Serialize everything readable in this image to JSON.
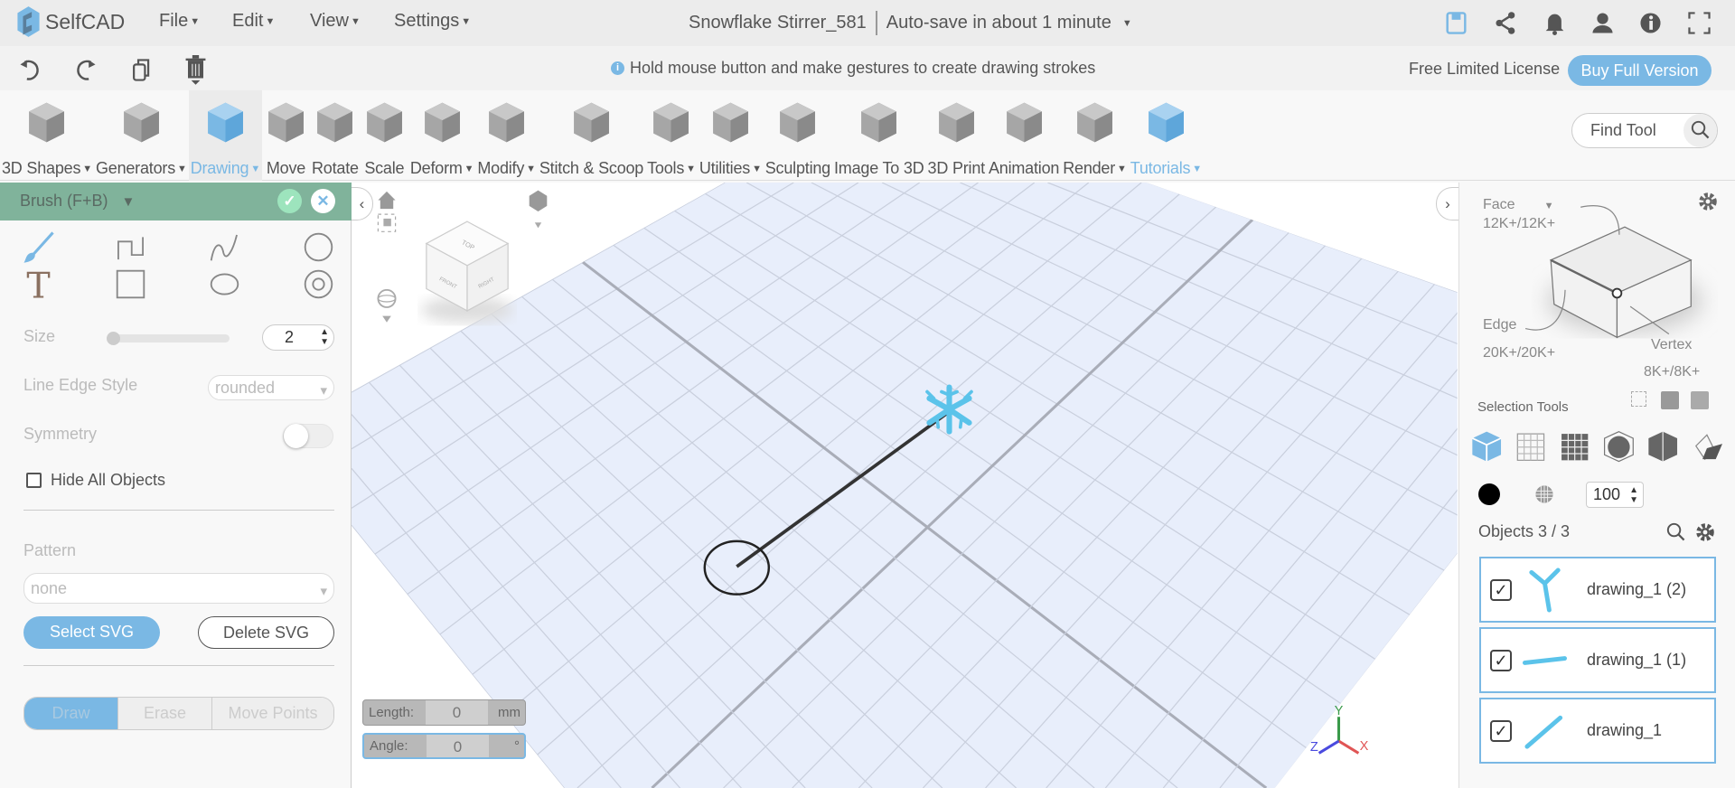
{
  "app": {
    "name": "SelfCAD"
  },
  "menu": [
    "File",
    "Edit",
    "View",
    "Settings"
  ],
  "document": {
    "title": "Snowflake Stirrer_581",
    "autosave": "Auto-save in about 1 minute"
  },
  "top_icons": [
    "save-icon",
    "share-icon",
    "bell-icon",
    "user-icon",
    "info-icon",
    "fullscreen-icon"
  ],
  "actions": [
    "undo-icon",
    "redo-icon",
    "copy-icon",
    "delete-icon"
  ],
  "hint": "Hold mouse button and make gestures to create drawing strokes",
  "license": "Free Limited License",
  "buy_label": "Buy Full Version",
  "toolbar": [
    {
      "label": "3D Shapes",
      "dropdown": true,
      "icon": "cube-icon"
    },
    {
      "label": "Generators",
      "dropdown": true,
      "icon": "generators-icon"
    },
    {
      "label": "Drawing",
      "dropdown": true,
      "icon": "drawing-icon",
      "active": true
    },
    {
      "label": "Move",
      "icon": "move-icon"
    },
    {
      "label": "Rotate",
      "icon": "rotate-icon"
    },
    {
      "label": "Scale",
      "icon": "scale-icon"
    },
    {
      "label": "Deform",
      "dropdown": true,
      "icon": "deform-icon"
    },
    {
      "label": "Modify",
      "dropdown": true,
      "icon": "modify-icon"
    },
    {
      "label": "Stitch & Scoop",
      "icon": "stitch-scoop-icon"
    },
    {
      "label": "Tools",
      "dropdown": true,
      "icon": "tools-icon"
    },
    {
      "label": "Utilities",
      "dropdown": true,
      "icon": "utilities-icon"
    },
    {
      "label": "Sculpting",
      "icon": "sculpting-icon"
    },
    {
      "label": "Image To 3D",
      "icon": "image-to-3d-icon"
    },
    {
      "label": "3D Print",
      "icon": "3d-print-icon"
    },
    {
      "label": "Animation",
      "icon": "animation-icon"
    },
    {
      "label": "Render",
      "dropdown": true,
      "icon": "render-icon"
    },
    {
      "label": "Tutorials",
      "dropdown": true,
      "icon": "tutorials-icon",
      "blue": true
    }
  ],
  "find_tool": "Find Tool",
  "brush": {
    "title": "Brush (F+B)",
    "size_label": "Size",
    "size_value": "2",
    "size_fraction": 0.0,
    "edge_label": "Line Edge Style",
    "edge_value": "rounded",
    "symmetry_label": "Symmetry",
    "symmetry_on": false,
    "hide_label": "Hide All Objects",
    "pattern_label": "Pattern",
    "pattern_value": "none",
    "select_svg": "Select SVG",
    "delete_svg": "Delete SVG",
    "modes": [
      "Draw",
      "Erase",
      "Move Points"
    ]
  },
  "measure": {
    "length_label": "Length:",
    "length_value": "0",
    "length_unit": "mm",
    "angle_label": "Angle:",
    "angle_value": "0",
    "angle_unit": "°"
  },
  "axes": {
    "x": "X",
    "y": "Y",
    "z": "Z"
  },
  "viewcube": {
    "top": "TOP",
    "front": "FRONT",
    "right": "RIGHT"
  },
  "selection": {
    "face_label": "Face",
    "face_count": "12K+/12K+",
    "edge_label": "Edge",
    "edge_count": "20K+/20K+",
    "vertex_label": "Vertex",
    "vertex_count": "8K+/8K+",
    "tools_label": "Selection Tools",
    "opacity": "100"
  },
  "objects": {
    "label": "Objects 3 / 3",
    "items": [
      "drawing_1 (2)",
      "drawing_1 (1)",
      "drawing_1"
    ]
  },
  "colors": {
    "accent": "#7ab8e4",
    "header": "#80b39b",
    "plane": "#e8eefb"
  }
}
